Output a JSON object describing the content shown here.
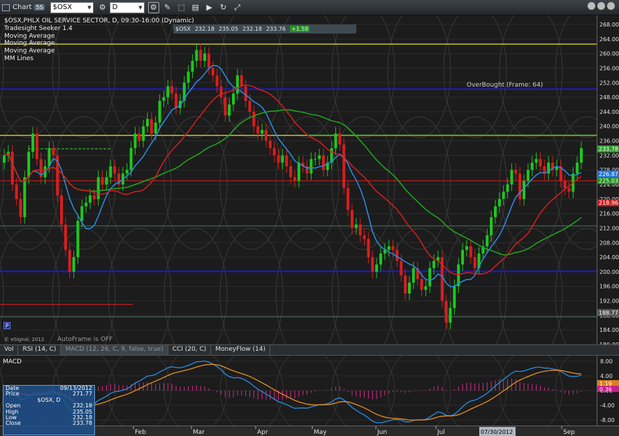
{
  "toolbar": {
    "title": "Chart",
    "badge": "5S",
    "symbol": "$OSX",
    "interval": "D"
  },
  "legend": {
    "line1": "$OSX,PHLX OIL SERVICE SECTOR, D, 09:30-16:00 (Dynamic)",
    "studies": [
      "Tradesight Seeker 1.4",
      "Moving Average",
      "Moving Average",
      "Moving Average",
      "MM Lines"
    ]
  },
  "quote_strip": {
    "symbol": "$OSX",
    "open": "232.18",
    "high": "235.05",
    "low": "232.18",
    "last": "233.76",
    "change": "+1.58"
  },
  "overbought_label": "OverBought (Frame: 64)",
  "autoframe_label": "AutoFrame is OFF",
  "esignal_label": "© eSignal, 2012",
  "p_badge": "P",
  "tabs": [
    {
      "label": "Vol",
      "active": false
    },
    {
      "label": "RSI (14, C)",
      "active": false
    },
    {
      "label": "MACD (12, 26, C, 9, false, true)",
      "active": true
    },
    {
      "label": "CCI (20, C)",
      "active": false
    },
    {
      "label": "MoneyFlow (14)",
      "active": false
    }
  ],
  "macd_label": "MACD",
  "infobox": {
    "date_label": "Date",
    "date_value": "09/13/2012",
    "price_label": "Price",
    "price_value": "271.77",
    "symbol_line": "$OSX, D",
    "open_label": "Open",
    "open_value": "232.18",
    "high_label": "High",
    "high_value": "235.05",
    "low_label": "Low",
    "low_value": "232.18",
    "close_label": "Close",
    "close_value": "233.78"
  },
  "price_axis": {
    "ticks": [
      "268.00",
      "264.00",
      "260.00",
      "256.00",
      "252.00",
      "248.00",
      "244.00",
      "240.00",
      "236.00",
      "232.00",
      "228.00",
      "224.00",
      "220.00",
      "216.00",
      "212.00",
      "208.00",
      "204.00",
      "200.00",
      "196.00",
      "192.00",
      "188.00",
      "184.00",
      "180.00"
    ],
    "tick_values": [
      268,
      264,
      260,
      256,
      252,
      248,
      244,
      240,
      236,
      232,
      228,
      224,
      220,
      216,
      212,
      208,
      204,
      200,
      196,
      192,
      188,
      184,
      180
    ],
    "ylim": [
      180,
      270.5
    ],
    "markers": [
      {
        "label": "233.78",
        "value": 233.78,
        "color": "#2e9e2e"
      },
      {
        "label": "226.87",
        "value": 226.87,
        "color": "#1e73d8"
      },
      {
        "label": "225.03",
        "value": 225.03,
        "color": "#1e8e1e"
      },
      {
        "label": "218.96",
        "value": 218.96,
        "color": "#c81e1e"
      },
      {
        "label": "188.77",
        "value": 188.77,
        "color": "#555555"
      }
    ]
  },
  "macd_axis": {
    "ticks": [
      "8.00",
      "4.00",
      "0.00",
      "-4.00",
      "-8.00"
    ],
    "tick_values": [
      8,
      4,
      0,
      -4,
      -8
    ],
    "ylim": [
      -9.5,
      9.5
    ],
    "markers": [
      {
        "label": "1.19",
        "value": 1.9,
        "color": "#d88020"
      },
      {
        "label": "0.36",
        "value": 0.36,
        "color": "#c81e8a"
      }
    ]
  },
  "date_axis": {
    "labels": [
      "Feb",
      "Mar",
      "Apr",
      "May",
      "Jun",
      "Jul",
      "07/30/2012",
      "Sep"
    ],
    "highlight": "07/30/2012"
  },
  "chart_data": {
    "type": "candlestick",
    "ylim": [
      180,
      270.5
    ],
    "horizontal_levels": [
      {
        "value": 262.6,
        "color": "#e6e61a"
      },
      {
        "value": 250.2,
        "color": "#1a1ad8"
      },
      {
        "value": 237.5,
        "color": "#e6e61a"
      },
      {
        "value": 225.0,
        "color": "#c81e1e"
      },
      {
        "value": 212.6,
        "color": "#4a6a5a"
      },
      {
        "value": 200.1,
        "color": "#1a1ad8"
      },
      {
        "value": 187.6,
        "color": "#4a6a5a"
      }
    ],
    "close": [
      232,
      233,
      224,
      220,
      215,
      226,
      233,
      238,
      231,
      226,
      229,
      234,
      232,
      221,
      213,
      206,
      200,
      204,
      214,
      218,
      219,
      221,
      220,
      226,
      224,
      226,
      229,
      227,
      224,
      227,
      228,
      234,
      238,
      236,
      240,
      242,
      238,
      241,
      247,
      248,
      251,
      249,
      245,
      247,
      252,
      255,
      258,
      261,
      258,
      260,
      256,
      254,
      251,
      248,
      243,
      246,
      249,
      254,
      251,
      247,
      244,
      240,
      238,
      239,
      236,
      234,
      232,
      230,
      232,
      229,
      226,
      225,
      230,
      229,
      227,
      231,
      231,
      232,
      228,
      230,
      234,
      238,
      235,
      223,
      217,
      212,
      213,
      210,
      209,
      204,
      200,
      202,
      205,
      206,
      207,
      206,
      203,
      199,
      194,
      197,
      201,
      198,
      195,
      196,
      201,
      203,
      204,
      192,
      186,
      190,
      196,
      202,
      206,
      207,
      204,
      201,
      205,
      207,
      210,
      215,
      218,
      220,
      222,
      224,
      228,
      227,
      220,
      225,
      228,
      230,
      231,
      229,
      227,
      230,
      228,
      229,
      225,
      223,
      222,
      227,
      230,
      234
    ]
  }
}
